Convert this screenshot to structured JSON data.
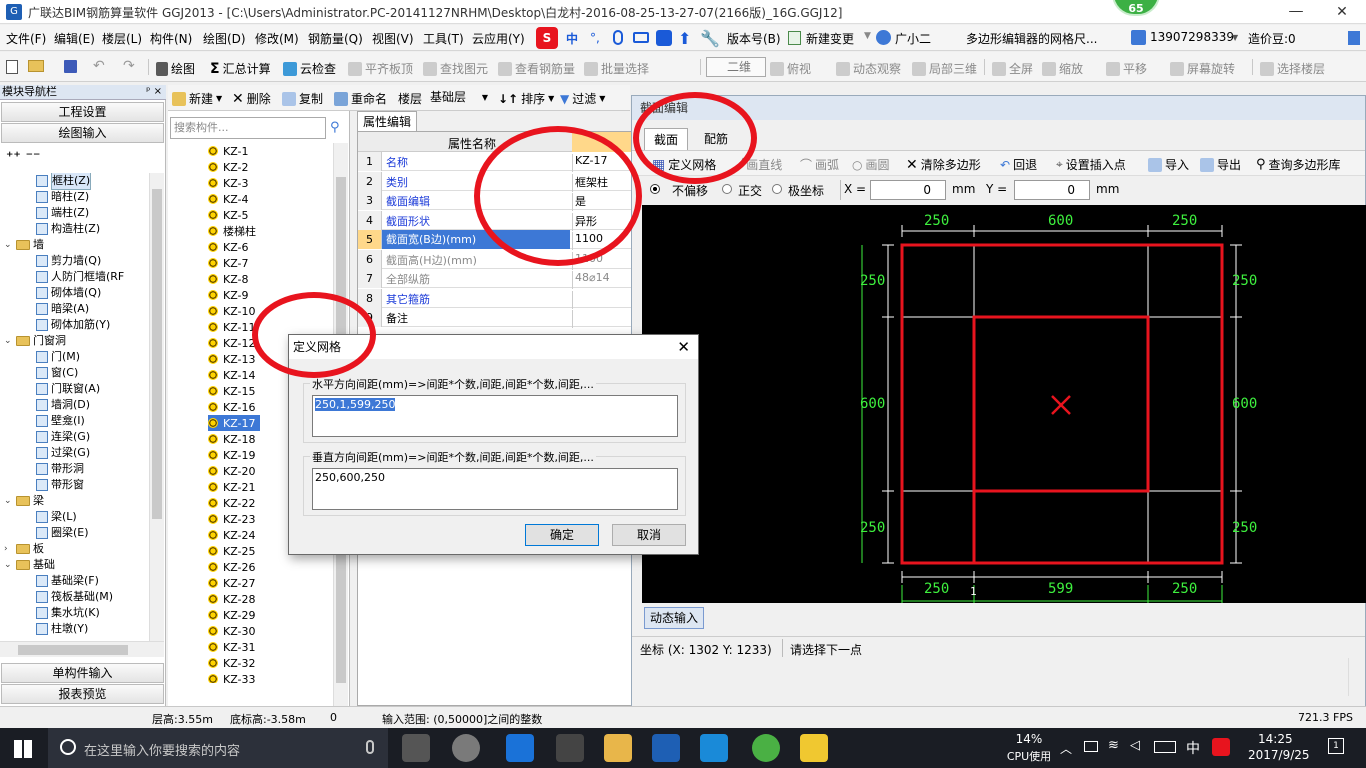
{
  "window": {
    "title": "广联达BIM钢筋算量软件 GGJ2013 - [C:\\Users\\Administrator.PC-20141127NRHM\\Desktop\\白龙村-2016-08-25-13-27-07(2166版)_16G.GGJ12]",
    "badge": "65",
    "min": "—",
    "max": "❐",
    "close": "✕"
  },
  "menu": {
    "items": [
      "文件(F)",
      "编辑(E)",
      "楼层(L)",
      "构件(N)",
      "绘图(D)",
      "修改(M)",
      "钢筋量(Q)",
      "视图(V)",
      "工具(T)",
      "云应用(Y)"
    ],
    "ime": "中",
    "version": "版本号(B)",
    "newchange": "新建变更",
    "assistant": "广小二",
    "notice": "多边形编辑器的网格尺...",
    "phone": "13907298339",
    "price": "造价豆:0"
  },
  "toolbar1": {
    "draw": "绘图",
    "sum": "汇总计算",
    "cloudcheck": "云检查",
    "flat": "平齐板顶",
    "find": "查找图元",
    "viewrebar": "查看钢筋量",
    "batch": "批量选择",
    "view2d": "二维",
    "topview": "俯视",
    "dynamic": "动态观察",
    "local3d": "局部三维",
    "fullscreen": "全屏",
    "zoom": "缩放",
    "pan": "平移",
    "rotate": "屏幕旋转",
    "selfloor": "选择楼层"
  },
  "toolbar2": {
    "new": "新建",
    "delete": "删除",
    "copy": "复制",
    "rename": "重命名",
    "floor": "楼层",
    "floorval": "基础层",
    "sort": "排序",
    "filter": "过滤"
  },
  "nav": {
    "header": "模块导航栏",
    "pin": "ᵖ × ",
    "project": "工程设置",
    "drawinput": "绘图输入",
    "single": "单构件输入",
    "report": "报表预览",
    "tree": [
      {
        "label": "框柱(Z)",
        "type": "leaf",
        "indent": 2,
        "sel": true
      },
      {
        "label": "暗柱(Z)",
        "type": "leaf",
        "indent": 2
      },
      {
        "label": "端柱(Z)",
        "type": "leaf",
        "indent": 2
      },
      {
        "label": "构造柱(Z)",
        "type": "leaf",
        "indent": 2
      },
      {
        "label": "墙",
        "type": "folder",
        "indent": 1
      },
      {
        "label": "剪力墙(Q)",
        "type": "leaf",
        "indent": 2
      },
      {
        "label": "人防门框墙(RF",
        "type": "leaf",
        "indent": 2
      },
      {
        "label": "砌体墙(Q)",
        "type": "leaf",
        "indent": 2
      },
      {
        "label": "暗梁(A)",
        "type": "leaf",
        "indent": 2
      },
      {
        "label": "砌体加筋(Y)",
        "type": "leaf",
        "indent": 2
      },
      {
        "label": "门窗洞",
        "type": "folder",
        "indent": 1
      },
      {
        "label": "门(M)",
        "type": "leaf",
        "indent": 2
      },
      {
        "label": "窗(C)",
        "type": "leaf",
        "indent": 2
      },
      {
        "label": "门联窗(A)",
        "type": "leaf",
        "indent": 2
      },
      {
        "label": "墙洞(D)",
        "type": "leaf",
        "indent": 2
      },
      {
        "label": "壁龛(I)",
        "type": "leaf",
        "indent": 2
      },
      {
        "label": "连梁(G)",
        "type": "leaf",
        "indent": 2
      },
      {
        "label": "过梁(G)",
        "type": "leaf",
        "indent": 2
      },
      {
        "label": "带形洞",
        "type": "leaf",
        "indent": 2
      },
      {
        "label": "带形窗",
        "type": "leaf",
        "indent": 2
      },
      {
        "label": "梁",
        "type": "folder",
        "indent": 1
      },
      {
        "label": "梁(L)",
        "type": "leaf",
        "indent": 2
      },
      {
        "label": "圈梁(E)",
        "type": "leaf",
        "indent": 2
      },
      {
        "label": "板",
        "type": "folder",
        "indent": 1,
        "collapsed": true
      },
      {
        "label": "基础",
        "type": "folder",
        "indent": 1
      },
      {
        "label": "基础梁(F)",
        "type": "leaf",
        "indent": 2
      },
      {
        "label": "筏板基础(M)",
        "type": "leaf",
        "indent": 2
      },
      {
        "label": "集水坑(K)",
        "type": "leaf",
        "indent": 2
      },
      {
        "label": "柱墩(Y)",
        "type": "leaf",
        "indent": 2
      }
    ]
  },
  "components": {
    "search_placeholder": "搜索构件...",
    "items": [
      "KZ-1",
      "KZ-2",
      "KZ-3",
      "KZ-4",
      "KZ-5",
      "楼梯柱",
      "KZ-6",
      "KZ-7",
      "KZ-8",
      "KZ-9",
      "KZ-10",
      "KZ-11",
      "KZ-12",
      "KZ-13",
      "KZ-14",
      "KZ-15",
      "KZ-16",
      "KZ-17",
      "KZ-18",
      "KZ-19",
      "KZ-20",
      "KZ-21",
      "KZ-22",
      "KZ-23",
      "KZ-24",
      "KZ-25",
      "KZ-26",
      "KZ-27",
      "KZ-28",
      "KZ-29",
      "KZ-30",
      "KZ-31",
      "KZ-32",
      "KZ-33"
    ],
    "selected": "KZ-17"
  },
  "props": {
    "tab": "属性编辑",
    "col_name": "属性名称",
    "rows": [
      {
        "n": "1",
        "name": "名称",
        "val": "KZ-17"
      },
      {
        "n": "2",
        "name": "类别",
        "val": "框架柱"
      },
      {
        "n": "3",
        "name": "截面编辑",
        "val": "是"
      },
      {
        "n": "4",
        "name": "截面形状",
        "val": "异形"
      },
      {
        "n": "5",
        "name": "截面宽(B边)(mm)",
        "val": "1100",
        "sel": true
      },
      {
        "n": "6",
        "name": "截面高(H边)(mm)",
        "val": "1100",
        "gray": true
      },
      {
        "n": "7",
        "name": "全部纵筋",
        "val": "48⌀14",
        "gray": true
      },
      {
        "n": "8",
        "name": "其它箍筋",
        "val": ""
      },
      {
        "n": "9",
        "name": "备注",
        "val": "",
        "black": true
      }
    ]
  },
  "section": {
    "title": "截面编辑",
    "tab_section": "截面",
    "tab_rebar": "配筋",
    "define_grid": "定义网格",
    "line": "画直线",
    "arc": "画弧",
    "circle": "画圆",
    "clear": "清除多边形",
    "undo": "回退",
    "insertpt": "设置插入点",
    "import": "导入",
    "export": "导出",
    "query": "查询多边形库",
    "opt_nooffset": "不偏移",
    "opt_ortho": "正交",
    "opt_polar": "极坐标",
    "x_label": "X =",
    "x_val": "0",
    "y_label": "Y =",
    "y_val": "0",
    "unit": "mm",
    "dyn_input": "动态输入",
    "coord": "坐标 (X: 1302 Y: 1233)",
    "prompt": "请选择下一点",
    "dims_top": [
      "250",
      "600",
      "250"
    ],
    "dims_left": [
      "250",
      "600",
      "250"
    ],
    "dims_right": [
      "250",
      "600",
      "250"
    ],
    "dims_bottom": [
      "250",
      "599",
      "250"
    ],
    "dim_bottom_tick": "1"
  },
  "dialog": {
    "title": "定义网格",
    "h_label": "水平方向间距(mm)=>间距*个数,间距,间距*个数,间距,...",
    "h_value": "250,1,599,250",
    "v_label": "垂直方向间距(mm)=>间距*个数,间距,间距*个数,间距,...",
    "v_value": "250,600,250",
    "ok": "确定",
    "cancel": "取消",
    "close": "✕"
  },
  "status": {
    "floor_h": "层高:3.55m",
    "bottom_h": "底标高:-3.58m",
    "zero": "0",
    "range": "输入范围: (0,50000]之间的整数",
    "fps": "721.3 FPS"
  },
  "taskbar": {
    "search": "在这里输入你要搜索的内容",
    "cpu": "14%",
    "cpu_label": "CPU使用",
    "ime": "中",
    "time": "14:25",
    "date": "2017/9/25",
    "notif": "1"
  }
}
